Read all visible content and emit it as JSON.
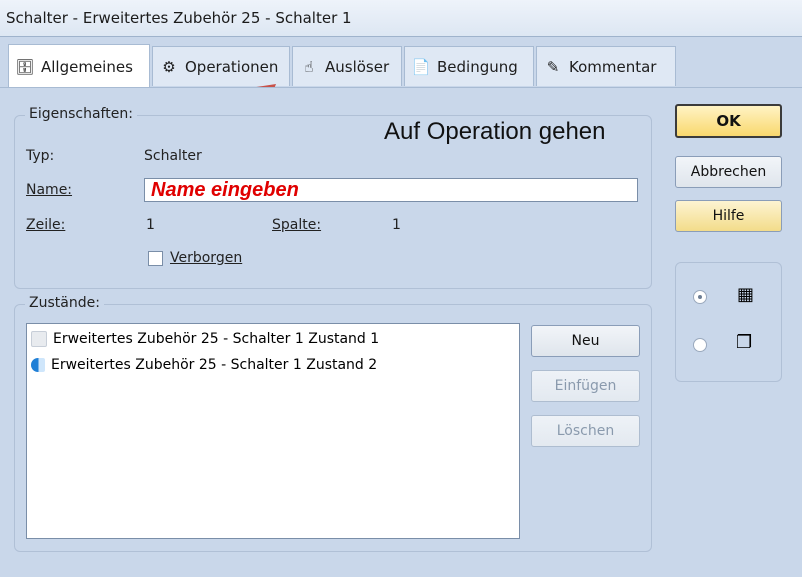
{
  "window": {
    "title": "Schalter - Erweitertes Zubehör 25 - Schalter 1"
  },
  "tabs": [
    {
      "label": "Allgemeines",
      "icon": "general-icon",
      "active": true
    },
    {
      "label": "Operationen",
      "icon": "operations-icon",
      "active": false
    },
    {
      "label": "Auslöser",
      "icon": "trigger-icon",
      "active": false
    },
    {
      "label": "Bedingung",
      "icon": "condition-icon",
      "active": false
    },
    {
      "label": "Kommentar",
      "icon": "comment-icon",
      "active": false
    }
  ],
  "properties": {
    "legend": "Eigenschaften:",
    "type_label": "Typ:",
    "type_value": "Schalter",
    "name_label": "Name:",
    "name_value": "Name eingeben",
    "row_label": "Zeile:",
    "row_value": "1",
    "column_label": "Spalte:",
    "column_value": "1",
    "hidden_label": "Verborgen"
  },
  "annotation": {
    "text": "Auf Operation gehen",
    "color": "#c8524a"
  },
  "states": {
    "legend": "Zustände:",
    "items": [
      {
        "label": "Erweitertes Zubehör 25 - Schalter 1 Zustand 1",
        "icon": "state-off-icon"
      },
      {
        "label": "Erweitertes Zubehör 25 - Schalter 1 Zustand 2",
        "icon": "state-on-icon"
      }
    ],
    "new_label": "Neu",
    "insert_label": "Einfügen",
    "delete_label": "Löschen"
  },
  "buttons": {
    "ok": "OK",
    "cancel": "Abbrechen",
    "help": "Hilfe"
  },
  "view_options": [
    {
      "icon": "list-view-icon",
      "selected": true
    },
    {
      "icon": "copy-view-icon",
      "selected": false
    }
  ]
}
